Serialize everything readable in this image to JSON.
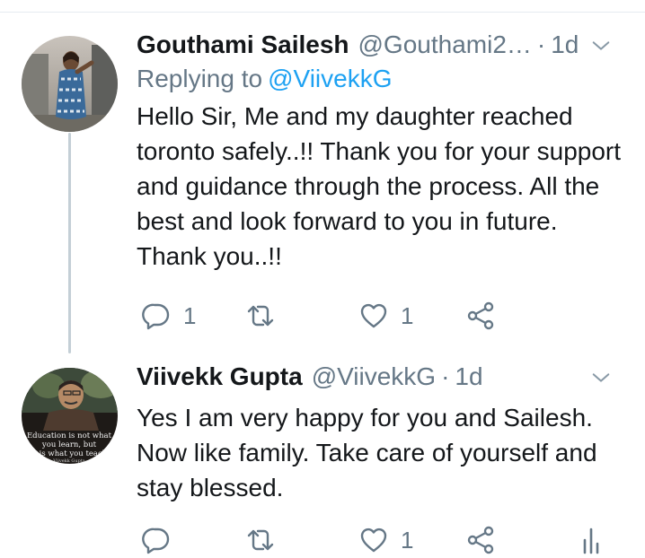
{
  "tweets": [
    {
      "name": "Gouthami Sailesh",
      "handle": "@Gouthami2…",
      "time": "1d",
      "replying_prefix": "Replying to",
      "replying_to": "@ViivekkG",
      "text": "Hello Sir, Me and my daughter reached toronto safely..!! Thank you for your support and guidance through the process. All the best and look forward to you in future. Thank you..!!",
      "reply_count": "1",
      "retweet_count": "",
      "like_count": "1"
    },
    {
      "name": "Viivekk Gupta",
      "handle": "@ViivekkG",
      "time": "1d",
      "text": "Yes I am very happy for you and Sailesh. Now like family. Take care of yourself and stay blessed.",
      "reply_count": "",
      "retweet_count": "",
      "like_count": "1",
      "avatar_caption": "Education is not what you learn, but it is what you teach",
      "avatar_signature": "Viivekk Gupta"
    }
  ],
  "colors": {
    "text": "#14171a",
    "secondary": "#657786",
    "link": "#1da1f2",
    "thread_line": "#c4cfd6"
  },
  "icons": [
    "reply-icon",
    "retweet-icon",
    "like-icon",
    "share-icon",
    "analytics-icon",
    "chevron-down-icon"
  ]
}
